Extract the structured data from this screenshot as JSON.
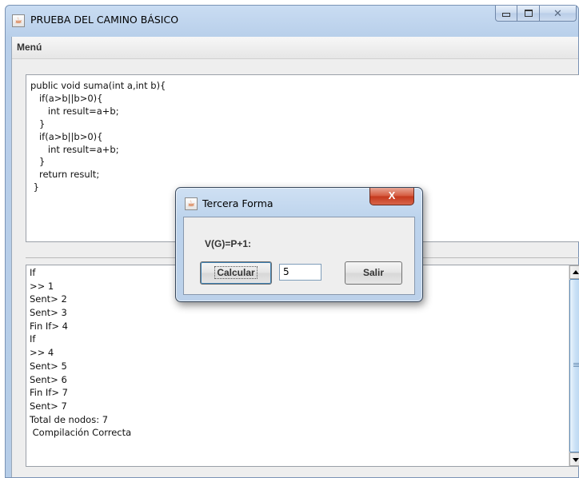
{
  "window": {
    "title": "PRUEBA DEL CAMINO BÁSICO",
    "icon": "java-cup-icon"
  },
  "menu": {
    "items": [
      "Menú"
    ]
  },
  "code": {
    "text": "public void suma(int a,int b){\n   if(a>b||b>0){\n      int result=a+b;\n   }\n   if(a>b||b>0){\n      int result=a+b;\n   }\n   return result;\n }"
  },
  "output": {
    "lines": [
      "If",
      ">> 1",
      "Sent> 2",
      "Sent> 3",
      "Fin If> 4",
      "If",
      ">> 4",
      "Sent> 5",
      "Sent> 6",
      "Fin If> 7",
      "Sent> 7",
      "Total de nodos: 7",
      " Compilación Correcta"
    ]
  },
  "dialog": {
    "title": "Tercera Forma",
    "formula_label": "V(G)=P+1:",
    "calculate_label": "Calcular",
    "result_value": "5",
    "exit_label": "Salir",
    "close_glyph": "X"
  },
  "colors": {
    "title_bar": "#c0d5ef",
    "close_button": "#c4381c",
    "scroll_thumb": "#c7dff5"
  }
}
